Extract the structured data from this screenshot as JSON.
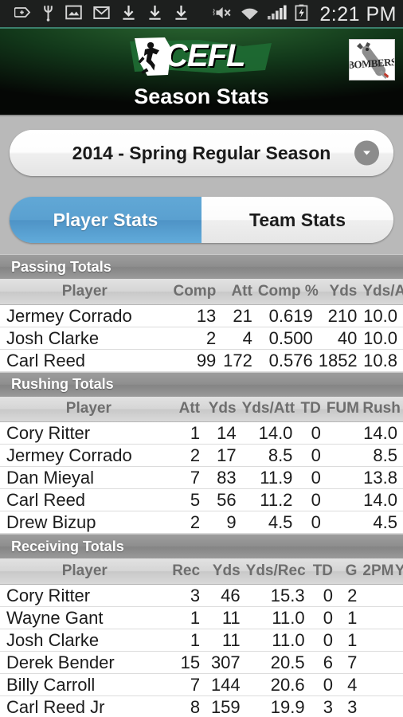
{
  "statusbar": {
    "icons": [
      "plus-badge-icon",
      "usb-icon",
      "photo-icon",
      "gmail-icon",
      "download-icon",
      "download-icon",
      "download-icon"
    ],
    "right_icons": [
      "mute-vibrate-icon",
      "wifi-icon",
      "signal-icon",
      "battery-charging-icon"
    ],
    "clock": "2:21 PM"
  },
  "header": {
    "logo_text": "CEFL",
    "logo_name": "cefl-logo",
    "team_logo_text": "BOMBERS",
    "page_title": "Season Stats",
    "accent_green": "#2d6b33"
  },
  "season_selector": {
    "value": "2014 - Spring Regular Season",
    "chevron": "chevron-down-icon"
  },
  "tabs": [
    {
      "label": "Player Stats",
      "active": true
    },
    {
      "label": "Team Stats",
      "active": false
    }
  ],
  "accent_blue": "#5aa0d0",
  "sections": [
    {
      "title": "Passing Totals",
      "columns": [
        "Player",
        "Comp",
        "Att",
        "Comp %",
        "Yds",
        "Yds/A"
      ],
      "rows": [
        [
          "Jermey Corrado",
          "13",
          "21",
          "0.619",
          "210",
          "10.0"
        ],
        [
          "Josh Clarke",
          "2",
          "4",
          "0.500",
          "40",
          "10.0"
        ],
        [
          "Carl Reed",
          "99",
          "172",
          "0.576",
          "1852",
          "10.8"
        ]
      ]
    },
    {
      "title": "Rushing Totals",
      "columns": [
        "Player",
        "Att",
        "Yds",
        "Yds/Att",
        "TD",
        "FUM",
        "Rush YP"
      ],
      "rows": [
        [
          "Cory Ritter",
          "1",
          "14",
          "14.0",
          "0",
          "",
          "14.0"
        ],
        [
          "Jermey Corrado",
          "2",
          "17",
          "8.5",
          "0",
          "",
          "8.5"
        ],
        [
          "Dan Mieyal",
          "7",
          "83",
          "11.9",
          "0",
          "",
          "13.8"
        ],
        [
          "Carl Reed",
          "5",
          "56",
          "11.2",
          "0",
          "",
          "14.0"
        ],
        [
          "Drew Bizup",
          "2",
          "9",
          "4.5",
          "0",
          "",
          "4.5"
        ]
      ]
    },
    {
      "title": "Receiving Totals",
      "columns": [
        "Player",
        "Rec",
        "Yds",
        "Yds/Rec",
        "TD",
        "G",
        "2PM",
        "Y"
      ],
      "rows": [
        [
          "Cory Ritter",
          "3",
          "46",
          "15.3",
          "0",
          "2",
          "",
          ""
        ],
        [
          "Wayne Gant",
          "1",
          "11",
          "11.0",
          "0",
          "1",
          "",
          ""
        ],
        [
          "Josh Clarke",
          "1",
          "11",
          "11.0",
          "0",
          "1",
          "",
          ""
        ],
        [
          "Derek Bender",
          "15",
          "307",
          "20.5",
          "6",
          "7",
          "",
          ""
        ],
        [
          "Billy Carroll",
          "7",
          "144",
          "20.6",
          "0",
          "4",
          "",
          ""
        ],
        [
          "Carl Reed Jr",
          "8",
          "159",
          "19.9",
          "3",
          "3",
          "",
          ""
        ]
      ]
    }
  ],
  "column_widths": [
    [
      "42%",
      "13%",
      "9%",
      "15%",
      "11%",
      "10%"
    ],
    [
      "44%",
      "7%",
      "9%",
      "14%",
      "7%",
      "9%",
      "10%"
    ],
    [
      "42%",
      "9%",
      "10%",
      "16%",
      "7%",
      "6%",
      "8%",
      "2%"
    ]
  ]
}
